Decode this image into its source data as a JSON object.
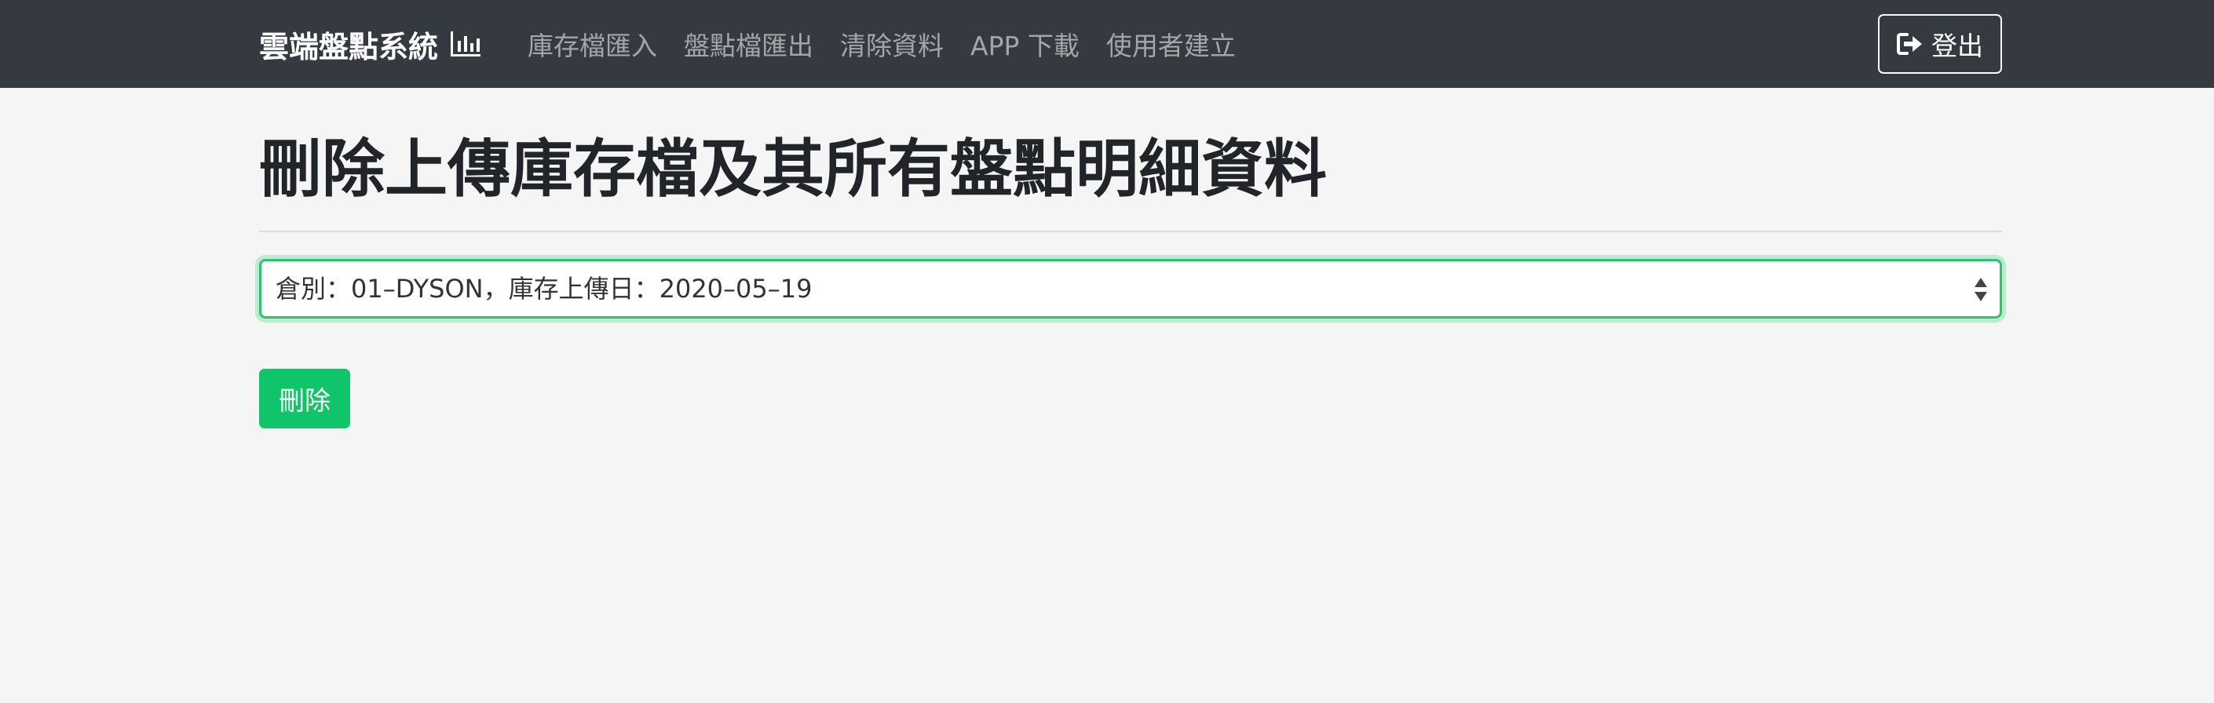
{
  "navbar": {
    "brand": "雲端盤點系統",
    "brand_icon": "bar-chart-icon",
    "links": [
      "庫存檔匯入",
      "盤點檔匯出",
      "清除資料",
      "APP 下載",
      "使用者建立"
    ],
    "logout_label": "登出",
    "logout_icon": "sign-out-icon"
  },
  "main": {
    "title": "刪除上傳庫存檔及其所有盤點明細資料",
    "selected_option": "倉別：01–DYSON，庫存上傳日：2020–05–19",
    "delete_label": "刪除"
  },
  "colors": {
    "navbar_bg": "#343a40",
    "page_bg": "#f5f5f5",
    "accent_green": "#10c469"
  }
}
